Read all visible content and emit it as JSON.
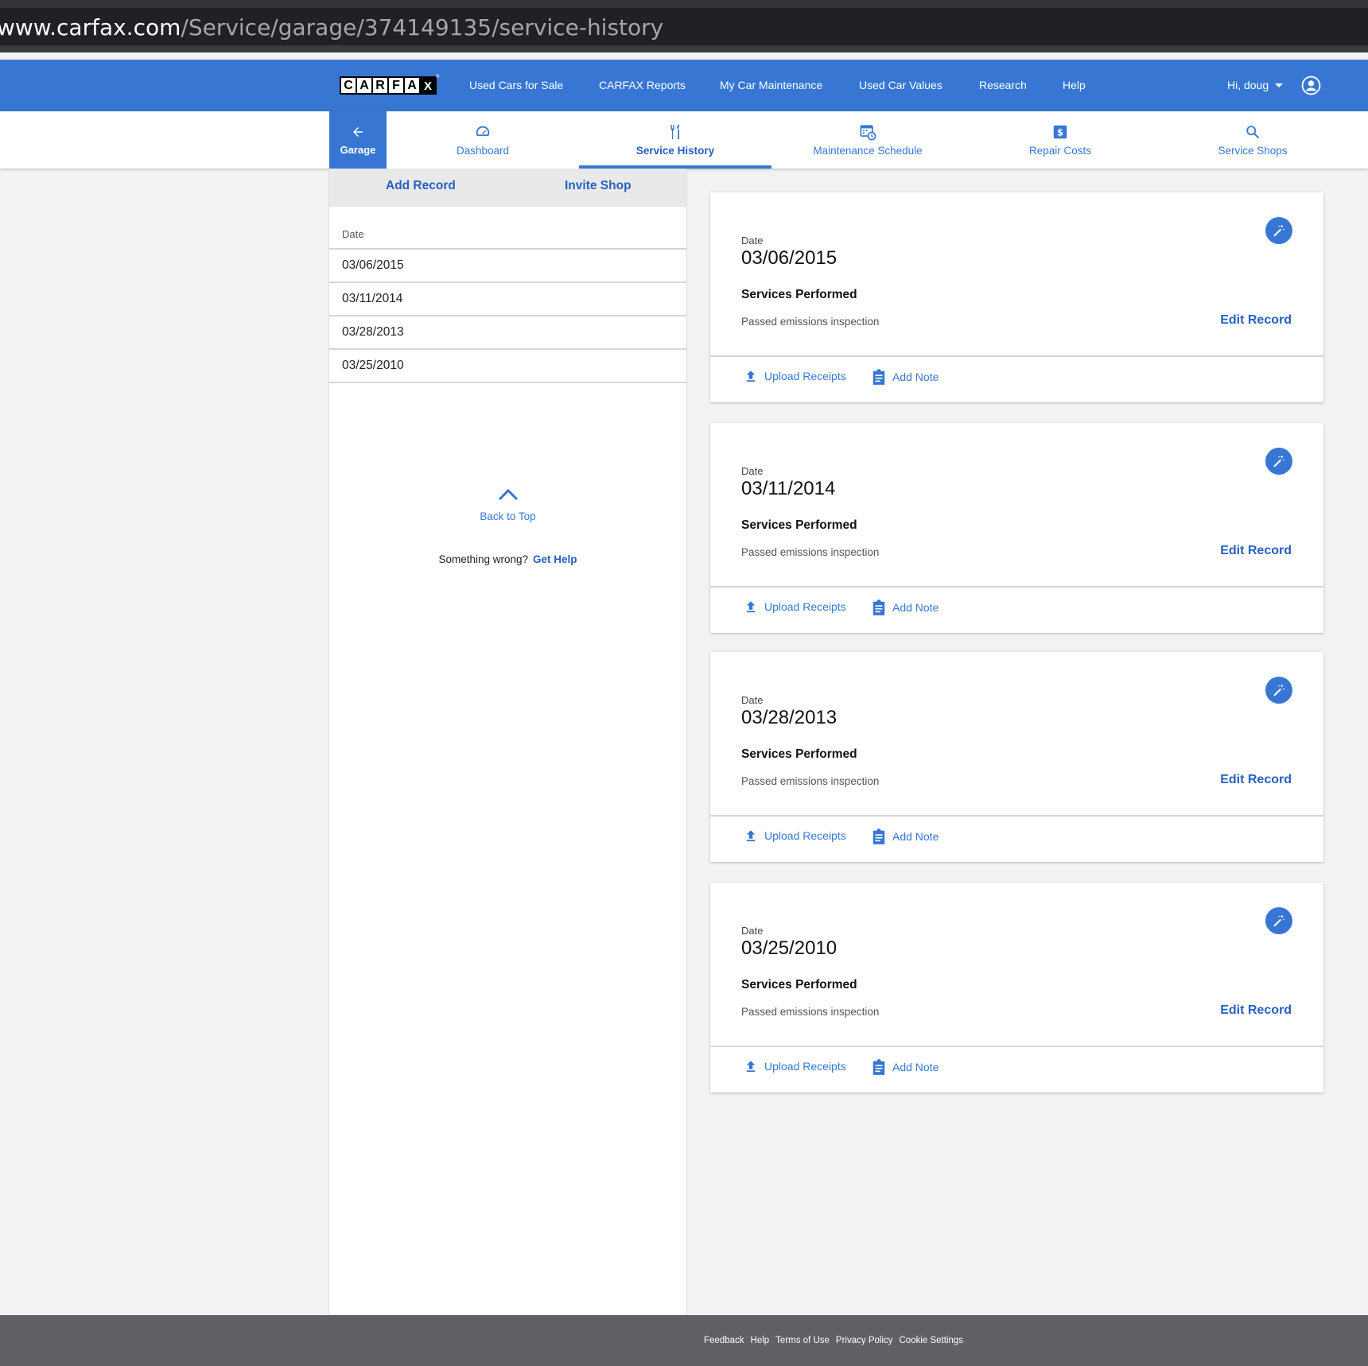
{
  "browser": {
    "url_host": "www.carfax.com",
    "url_path": "/Service/garage/374149135/service-history"
  },
  "topnav": {
    "logo_text": "CARFAX",
    "links": [
      "Used Cars for Sale",
      "CARFAX Reports",
      "My Car Maintenance",
      "Used Car Values",
      "Research",
      "Help"
    ],
    "user_greeting": "Hi, doug",
    "account_icon": "account-circle-icon"
  },
  "subnav": {
    "garage_label": "Garage",
    "tabs": [
      {
        "label": "Dashboard",
        "icon": "speedometer-icon"
      },
      {
        "label": "Service History",
        "icon": "tools-icon",
        "active": true
      },
      {
        "label": "Maintenance Schedule",
        "icon": "calendar-clock-icon"
      },
      {
        "label": "Repair Costs",
        "icon": "dollar-icon"
      },
      {
        "label": "Service Shops",
        "icon": "search-icon"
      }
    ]
  },
  "left_panel": {
    "add_record": "Add Record",
    "invite_shop": "Invite Shop",
    "date_header": "Date",
    "dates": [
      "03/06/2015",
      "03/11/2014",
      "03/28/2013",
      "03/25/2010"
    ],
    "back_to_top": "Back to Top",
    "something_wrong": "Something wrong?",
    "get_help": "Get Help"
  },
  "records": [
    {
      "date_label": "Date",
      "date": "03/06/2015",
      "services_label": "Services Performed",
      "services": "Passed emissions inspection",
      "edit": "Edit Record",
      "upload": "Upload Receipts",
      "note": "Add Note"
    },
    {
      "date_label": "Date",
      "date": "03/11/2014",
      "services_label": "Services Performed",
      "services": "Passed emissions inspection",
      "edit": "Edit Record",
      "upload": "Upload Receipts",
      "note": "Add Note"
    },
    {
      "date_label": "Date",
      "date": "03/28/2013",
      "services_label": "Services Performed",
      "services": "Passed emissions inspection",
      "edit": "Edit Record",
      "upload": "Upload Receipts",
      "note": "Add Note"
    },
    {
      "date_label": "Date",
      "date": "03/25/2010",
      "services_label": "Services Performed",
      "services": "Passed emissions inspection",
      "edit": "Edit Record",
      "upload": "Upload Receipts",
      "note": "Add Note"
    }
  ],
  "footer": {
    "links": [
      "Feedback",
      "Help",
      "Terms of Use",
      "Privacy Policy",
      "Cookie Settings"
    ]
  },
  "colors": {
    "brand_blue": "#3777d3",
    "link_blue": "#2760c0",
    "footer_gray": "#5f6165"
  }
}
